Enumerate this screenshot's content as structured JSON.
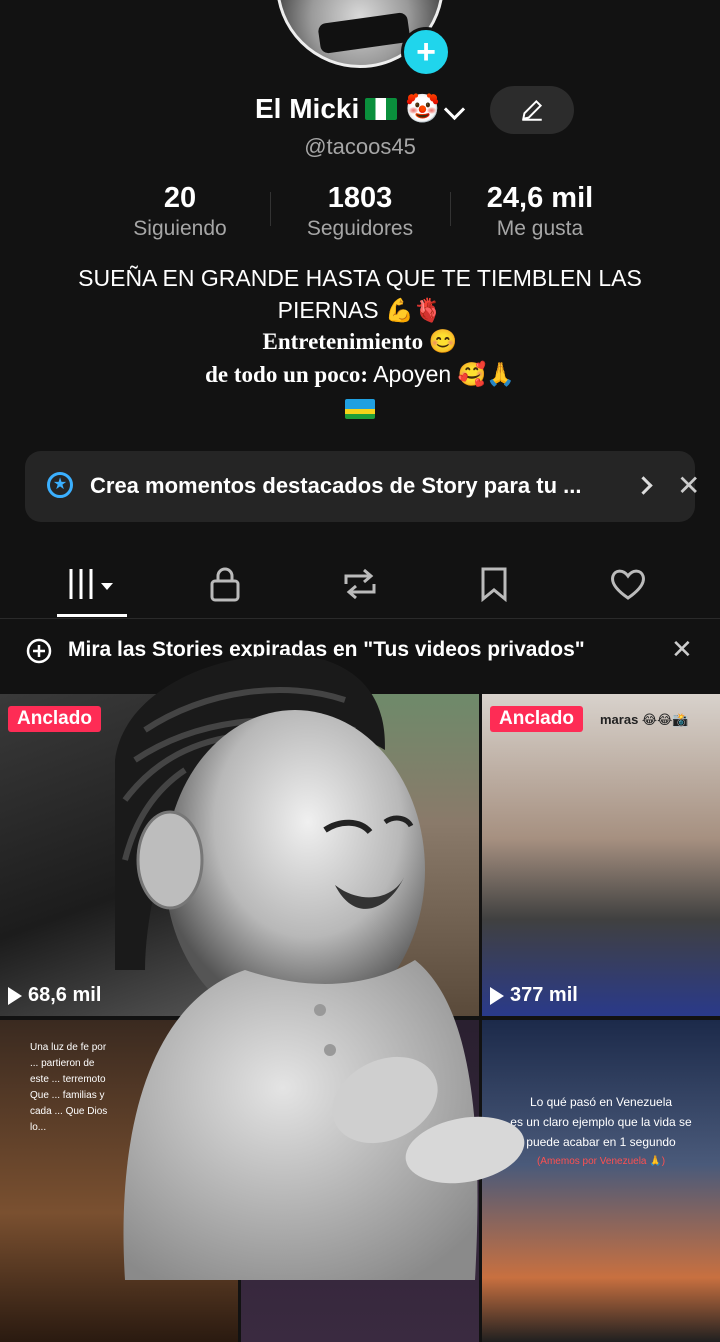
{
  "profile": {
    "name": "El Micki",
    "username": "@tacoos45",
    "add_symbol": "+"
  },
  "stats": [
    {
      "value": "20",
      "label": "Siguiendo"
    },
    {
      "value": "1803",
      "label": "Seguidores"
    },
    {
      "value": "24,6 mil",
      "label": "Me gusta"
    }
  ],
  "bio": {
    "line1": "SUEÑA EN GRANDE HASTA QUE TE TIEMBLEN LAS PIERNAS 💪🫀",
    "line2": "Entretenimiento 😊",
    "line3_bold": "de todo un poco:",
    "line3_rest": " Apoyen 🥰🙏"
  },
  "story_banner": {
    "text": "Crea momentos destacados de Story para tu ..."
  },
  "tabs": [
    "videos",
    "private",
    "reposts",
    "favorites",
    "liked"
  ],
  "notice": {
    "text": "Mira las Stories expiradas en \"Tus videos privados\""
  },
  "videos": [
    {
      "pinned_label": "Anclado",
      "views": "68,6 mil"
    },
    {
      "pinned_label": "",
      "views": ""
    },
    {
      "pinned_label": "Anclado",
      "views": "377 mil",
      "caption": "maras 😂😂📸"
    },
    {
      "caption_top": "Una luz de fe por ... partieron de este ... terremoto Que ... familias y cada ... Que Dios lo..."
    },
    {},
    {
      "caption_lines": [
        "Lo qué pasó en Venezuela",
        "es un claro ejemplo que la vida se",
        "puede acabar en 1 segundo"
      ],
      "caption_red": "(Amemos por Venezuela 🙏)"
    }
  ],
  "colors": {
    "background": "#121212",
    "accent_cyan": "#20d5ec",
    "pin_red": "#fe2c55",
    "muted_text": "#a6a6a6"
  }
}
